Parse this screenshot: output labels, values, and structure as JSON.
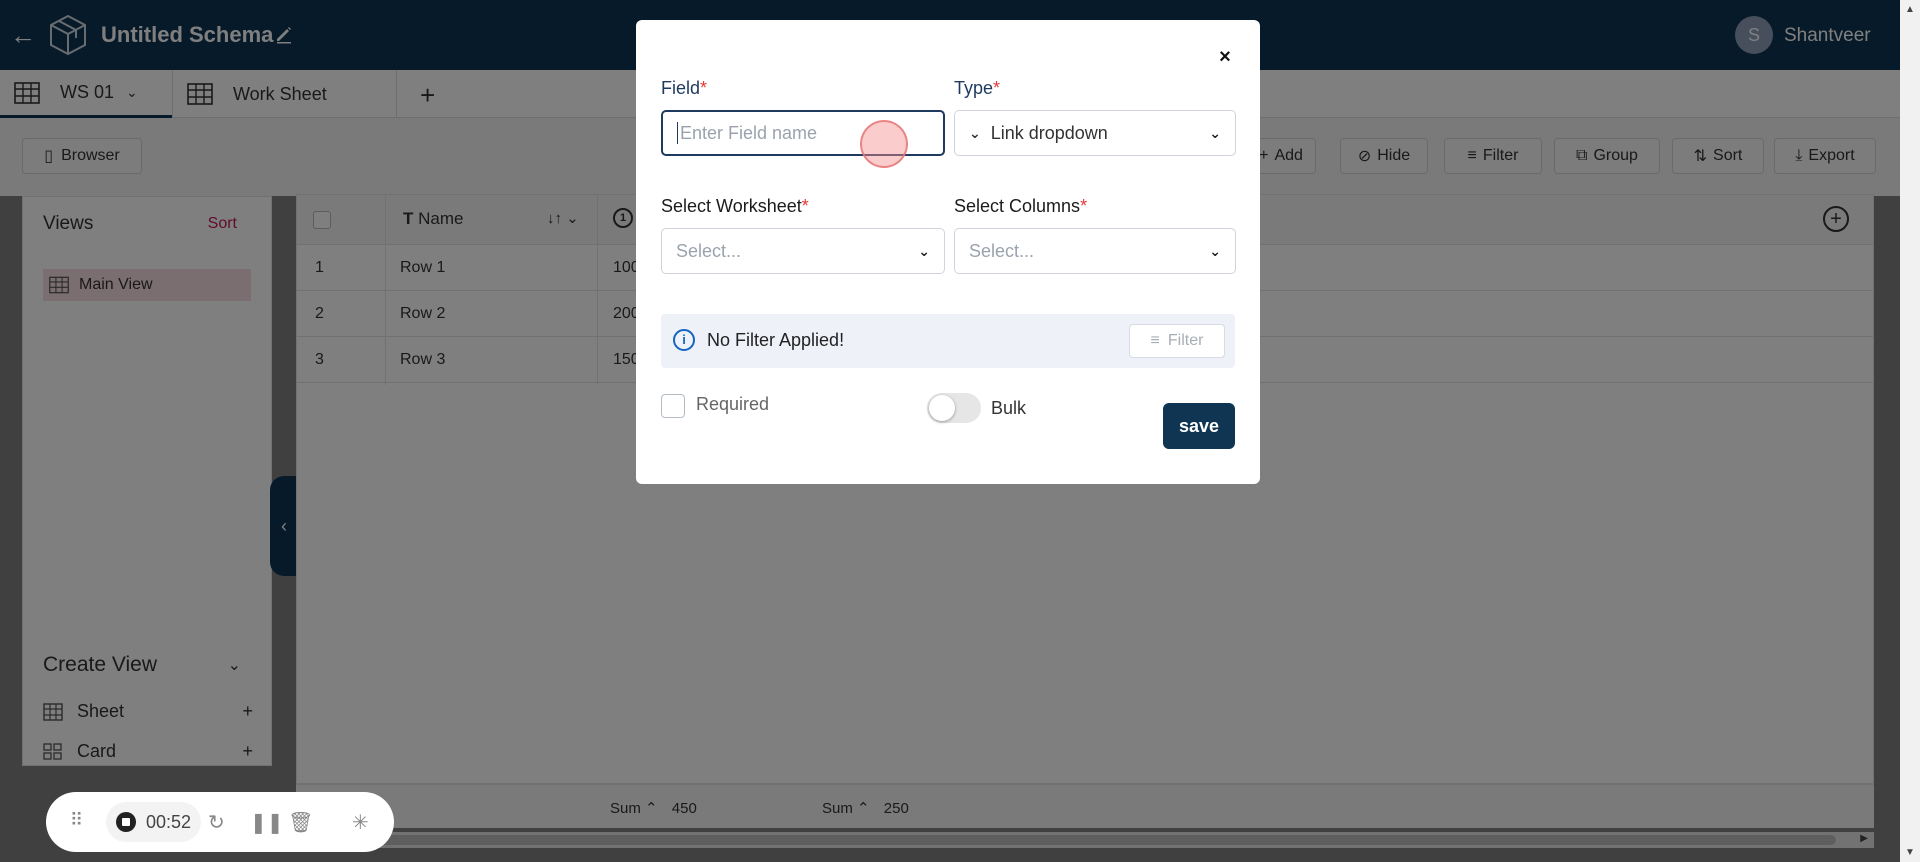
{
  "app": {
    "title": "Untitled Schema",
    "user_initial": "S",
    "user_name": "Shantveer"
  },
  "tabs": [
    {
      "label": "WS 01",
      "active": true
    },
    {
      "label": "Work Sheet",
      "active": false
    }
  ],
  "toolbar": {
    "browser_label": "Browser",
    "add_label": "Add",
    "hide_label": "Hide",
    "filter_label": "Filter",
    "group_label": "Group",
    "sort_label": "Sort",
    "export_label": "Export"
  },
  "sidebar": {
    "views_title": "Views",
    "sort_label": "Sort",
    "main_view_label": "Main View",
    "create_view_title": "Create View",
    "create_items": [
      {
        "label": "Sheet",
        "icon": "grid-icon"
      },
      {
        "label": "Card",
        "icon": "card-icon"
      }
    ]
  },
  "table": {
    "header_name": "Name",
    "rows": [
      {
        "index": "1",
        "name": "Row 1",
        "value": "100"
      },
      {
        "index": "2",
        "name": "Row 2",
        "value": "200"
      },
      {
        "index": "3",
        "name": "Row 3",
        "value": "150"
      }
    ],
    "footer": [
      {
        "label": "Sum",
        "value": "450"
      },
      {
        "label": "Sum",
        "value": "250"
      }
    ]
  },
  "recorder": {
    "time": "00:52"
  },
  "modal": {
    "field_label": "Field",
    "field_placeholder": "Enter Field name",
    "type_label": "Type",
    "type_value": "Link dropdown",
    "worksheet_label": "Select Worksheet",
    "worksheet_placeholder": "Select...",
    "columns_label": "Select Columns",
    "columns_placeholder": "Select...",
    "no_filter_text": "No Filter Applied!",
    "filter_button": "Filter",
    "required_label": "Required",
    "bulk_label": "Bulk",
    "save_label": "save",
    "required_star": "*"
  },
  "colors": {
    "primary": "#0f3552",
    "accent_red": "#e53935",
    "sort_pink": "#c2185b"
  }
}
